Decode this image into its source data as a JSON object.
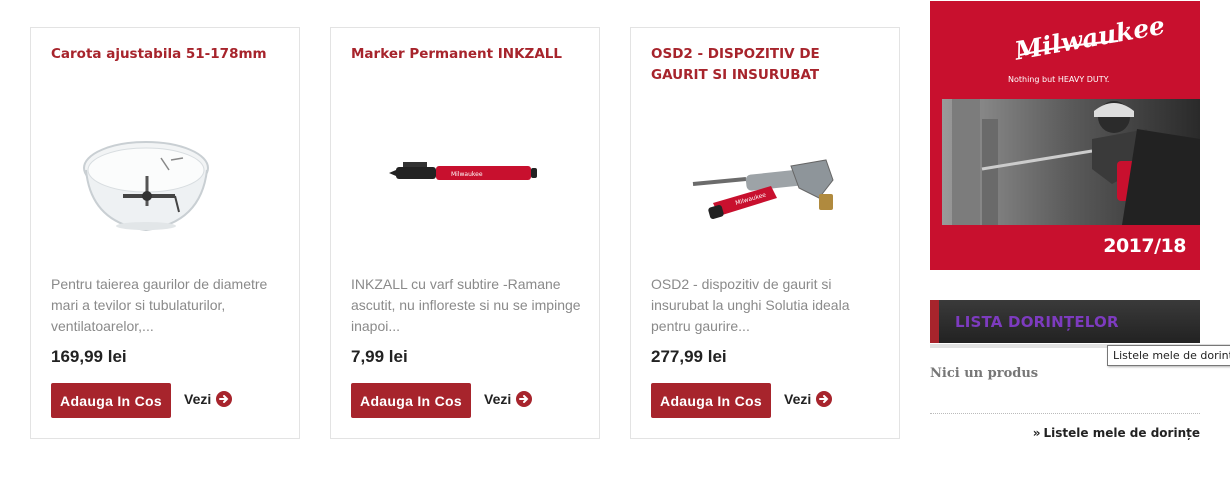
{
  "products": [
    {
      "title": "Carota ajustabila 51-178mm",
      "description": "Pentru taierea gaurilor de diametre mari a tevilor si tubulaturilor, ventilatoarelor,...",
      "price": "169,99 lei",
      "image_icon": "adjustable-hole-saw-icon"
    },
    {
      "title": "Marker Permanent INKZALL",
      "description": "INKZALL cu varf subtire -Ramane ascutit, nu infloreste si nu se impinge inapoi...",
      "price": "7,99 lei",
      "image_icon": "permanent-marker-icon"
    },
    {
      "title": "OSD2 - DISPOZITIV DE GAURIT SI INSURUBAT",
      "description": "OSD2 - dispozitiv de gaurit si insurubat la unghi Solutia ideala pentru gaurire...",
      "price": "277,99 lei",
      "image_icon": "right-angle-drill-adapter-icon"
    }
  ],
  "buttons": {
    "add_to_cart": "Adauga In Cos",
    "view": "Vezi"
  },
  "banner": {
    "brand": "Milwaukee",
    "tagline": "Nothing but HEAVY DUTY.",
    "year": "2017/18",
    "background_color": "#c8102e"
  },
  "wishlist": {
    "title": "LISTA DORINȚELOR",
    "tooltip": "Listele mele de dorințe",
    "empty_text": "Nici un produs",
    "link_prefix": "»",
    "link_label": "Listele mele de dorințe"
  },
  "colors": {
    "accent": "#a7242c",
    "wishlist_title": "#7d3bbf"
  }
}
